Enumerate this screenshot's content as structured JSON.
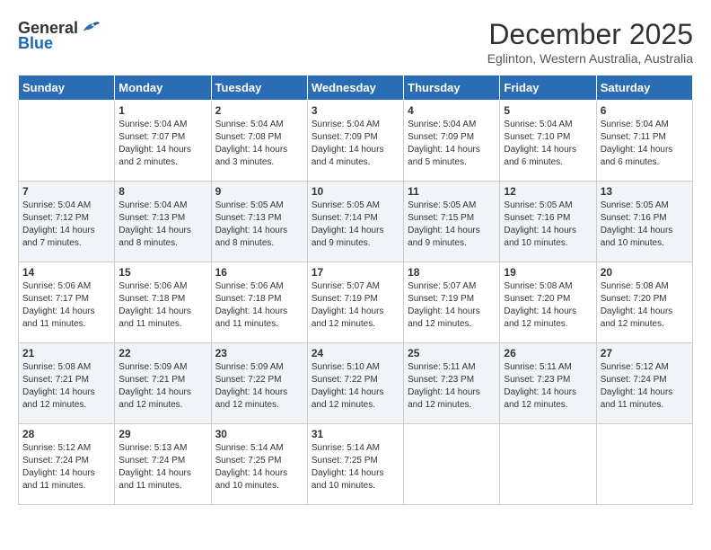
{
  "header": {
    "logo_general": "General",
    "logo_blue": "Blue",
    "title": "December 2025",
    "location": "Eglinton, Western Australia, Australia"
  },
  "days_of_week": [
    "Sunday",
    "Monday",
    "Tuesday",
    "Wednesday",
    "Thursday",
    "Friday",
    "Saturday"
  ],
  "weeks": [
    [
      {
        "day": "",
        "sunrise": "",
        "sunset": "",
        "daylight": ""
      },
      {
        "day": "1",
        "sunrise": "Sunrise: 5:04 AM",
        "sunset": "Sunset: 7:07 PM",
        "daylight": "Daylight: 14 hours and 2 minutes."
      },
      {
        "day": "2",
        "sunrise": "Sunrise: 5:04 AM",
        "sunset": "Sunset: 7:08 PM",
        "daylight": "Daylight: 14 hours and 3 minutes."
      },
      {
        "day": "3",
        "sunrise": "Sunrise: 5:04 AM",
        "sunset": "Sunset: 7:09 PM",
        "daylight": "Daylight: 14 hours and 4 minutes."
      },
      {
        "day": "4",
        "sunrise": "Sunrise: 5:04 AM",
        "sunset": "Sunset: 7:09 PM",
        "daylight": "Daylight: 14 hours and 5 minutes."
      },
      {
        "day": "5",
        "sunrise": "Sunrise: 5:04 AM",
        "sunset": "Sunset: 7:10 PM",
        "daylight": "Daylight: 14 hours and 6 minutes."
      },
      {
        "day": "6",
        "sunrise": "Sunrise: 5:04 AM",
        "sunset": "Sunset: 7:11 PM",
        "daylight": "Daylight: 14 hours and 6 minutes."
      }
    ],
    [
      {
        "day": "7",
        "sunrise": "Sunrise: 5:04 AM",
        "sunset": "Sunset: 7:12 PM",
        "daylight": "Daylight: 14 hours and 7 minutes."
      },
      {
        "day": "8",
        "sunrise": "Sunrise: 5:04 AM",
        "sunset": "Sunset: 7:13 PM",
        "daylight": "Daylight: 14 hours and 8 minutes."
      },
      {
        "day": "9",
        "sunrise": "Sunrise: 5:05 AM",
        "sunset": "Sunset: 7:13 PM",
        "daylight": "Daylight: 14 hours and 8 minutes."
      },
      {
        "day": "10",
        "sunrise": "Sunrise: 5:05 AM",
        "sunset": "Sunset: 7:14 PM",
        "daylight": "Daylight: 14 hours and 9 minutes."
      },
      {
        "day": "11",
        "sunrise": "Sunrise: 5:05 AM",
        "sunset": "Sunset: 7:15 PM",
        "daylight": "Daylight: 14 hours and 9 minutes."
      },
      {
        "day": "12",
        "sunrise": "Sunrise: 5:05 AM",
        "sunset": "Sunset: 7:16 PM",
        "daylight": "Daylight: 14 hours and 10 minutes."
      },
      {
        "day": "13",
        "sunrise": "Sunrise: 5:05 AM",
        "sunset": "Sunset: 7:16 PM",
        "daylight": "Daylight: 14 hours and 10 minutes."
      }
    ],
    [
      {
        "day": "14",
        "sunrise": "Sunrise: 5:06 AM",
        "sunset": "Sunset: 7:17 PM",
        "daylight": "Daylight: 14 hours and 11 minutes."
      },
      {
        "day": "15",
        "sunrise": "Sunrise: 5:06 AM",
        "sunset": "Sunset: 7:18 PM",
        "daylight": "Daylight: 14 hours and 11 minutes."
      },
      {
        "day": "16",
        "sunrise": "Sunrise: 5:06 AM",
        "sunset": "Sunset: 7:18 PM",
        "daylight": "Daylight: 14 hours and 11 minutes."
      },
      {
        "day": "17",
        "sunrise": "Sunrise: 5:07 AM",
        "sunset": "Sunset: 7:19 PM",
        "daylight": "Daylight: 14 hours and 12 minutes."
      },
      {
        "day": "18",
        "sunrise": "Sunrise: 5:07 AM",
        "sunset": "Sunset: 7:19 PM",
        "daylight": "Daylight: 14 hours and 12 minutes."
      },
      {
        "day": "19",
        "sunrise": "Sunrise: 5:08 AM",
        "sunset": "Sunset: 7:20 PM",
        "daylight": "Daylight: 14 hours and 12 minutes."
      },
      {
        "day": "20",
        "sunrise": "Sunrise: 5:08 AM",
        "sunset": "Sunset: 7:20 PM",
        "daylight": "Daylight: 14 hours and 12 minutes."
      }
    ],
    [
      {
        "day": "21",
        "sunrise": "Sunrise: 5:08 AM",
        "sunset": "Sunset: 7:21 PM",
        "daylight": "Daylight: 14 hours and 12 minutes."
      },
      {
        "day": "22",
        "sunrise": "Sunrise: 5:09 AM",
        "sunset": "Sunset: 7:21 PM",
        "daylight": "Daylight: 14 hours and 12 minutes."
      },
      {
        "day": "23",
        "sunrise": "Sunrise: 5:09 AM",
        "sunset": "Sunset: 7:22 PM",
        "daylight": "Daylight: 14 hours and 12 minutes."
      },
      {
        "day": "24",
        "sunrise": "Sunrise: 5:10 AM",
        "sunset": "Sunset: 7:22 PM",
        "daylight": "Daylight: 14 hours and 12 minutes."
      },
      {
        "day": "25",
        "sunrise": "Sunrise: 5:11 AM",
        "sunset": "Sunset: 7:23 PM",
        "daylight": "Daylight: 14 hours and 12 minutes."
      },
      {
        "day": "26",
        "sunrise": "Sunrise: 5:11 AM",
        "sunset": "Sunset: 7:23 PM",
        "daylight": "Daylight: 14 hours and 12 minutes."
      },
      {
        "day": "27",
        "sunrise": "Sunrise: 5:12 AM",
        "sunset": "Sunset: 7:24 PM",
        "daylight": "Daylight: 14 hours and 11 minutes."
      }
    ],
    [
      {
        "day": "28",
        "sunrise": "Sunrise: 5:12 AM",
        "sunset": "Sunset: 7:24 PM",
        "daylight": "Daylight: 14 hours and 11 minutes."
      },
      {
        "day": "29",
        "sunrise": "Sunrise: 5:13 AM",
        "sunset": "Sunset: 7:24 PM",
        "daylight": "Daylight: 14 hours and 11 minutes."
      },
      {
        "day": "30",
        "sunrise": "Sunrise: 5:14 AM",
        "sunset": "Sunset: 7:25 PM",
        "daylight": "Daylight: 14 hours and 10 minutes."
      },
      {
        "day": "31",
        "sunrise": "Sunrise: 5:14 AM",
        "sunset": "Sunset: 7:25 PM",
        "daylight": "Daylight: 14 hours and 10 minutes."
      },
      {
        "day": "",
        "sunrise": "",
        "sunset": "",
        "daylight": ""
      },
      {
        "day": "",
        "sunrise": "",
        "sunset": "",
        "daylight": ""
      },
      {
        "day": "",
        "sunrise": "",
        "sunset": "",
        "daylight": ""
      }
    ]
  ]
}
